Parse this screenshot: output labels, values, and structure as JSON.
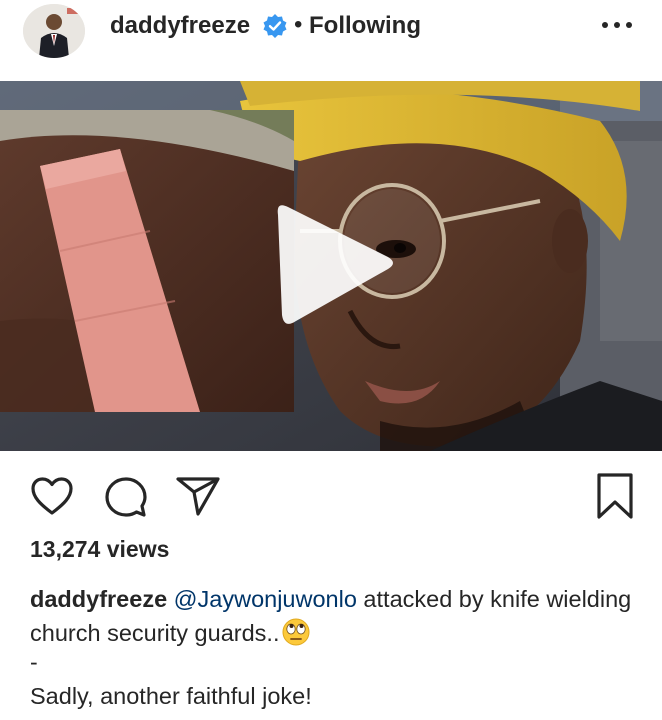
{
  "post": {
    "username": "daddyfreeze",
    "separator": "•",
    "follow_status": "Following",
    "media_type": "video",
    "views": "13,274 views",
    "caption": {
      "username": "daddyfreeze",
      "mention": "@Jaywonjuwonlo",
      "text": " attacked by knife wielding church security guards..",
      "emoji": "face-with-rolling-eyes",
      "dash": "-",
      "line2": "Sadly, another faithful joke!"
    }
  },
  "icons": {
    "verified": "verified-badge-icon",
    "more": "more-options-icon",
    "play": "play-icon",
    "like": "heart-icon",
    "comment": "comment-icon",
    "share": "share-icon",
    "save": "bookmark-icon"
  },
  "colors": {
    "text": "#262626",
    "verified_blue": "#3897f0",
    "mention": "#003569",
    "background": "#ffffff"
  }
}
